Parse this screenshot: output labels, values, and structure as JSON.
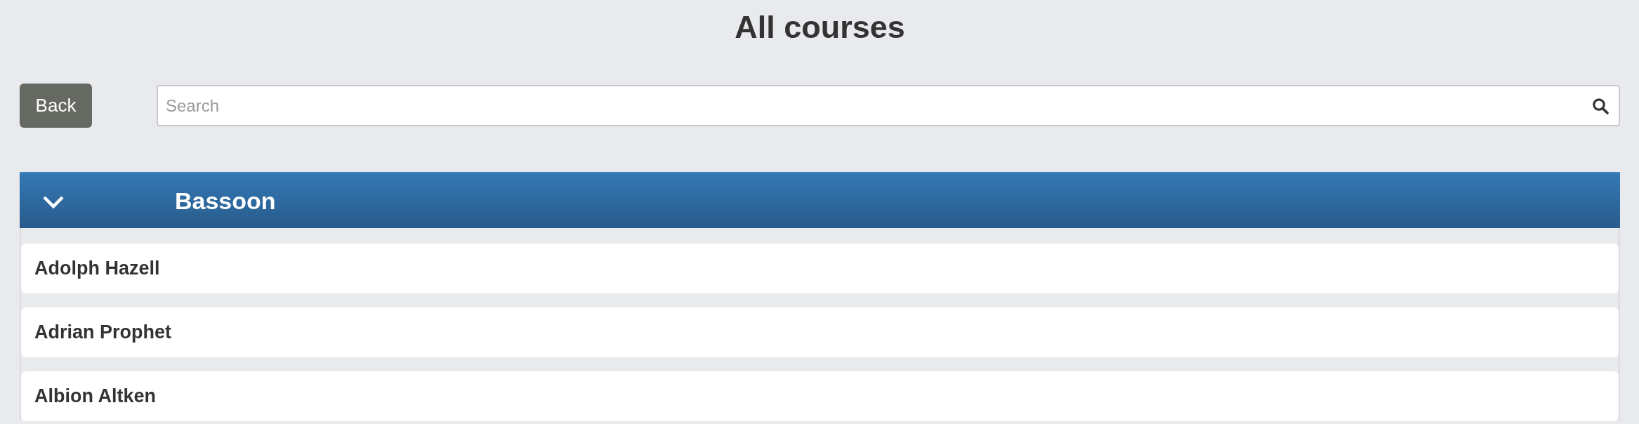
{
  "page": {
    "title": "All courses"
  },
  "toolbar": {
    "back_button": "Back",
    "search": {
      "placeholder": "Search"
    }
  },
  "group": {
    "title": "Bassoon",
    "expanded": true,
    "items": [
      {
        "name": "Adolph Hazell"
      },
      {
        "name": "Adrian Prophet"
      },
      {
        "name": "Albion Altken"
      }
    ]
  }
}
